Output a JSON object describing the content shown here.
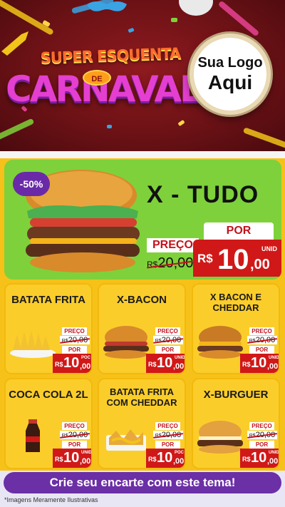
{
  "header": {
    "title_line1": "SUPER ESQUENTA",
    "title_de": "DE",
    "title_line2": "CARNAVAL",
    "logo_line1": "Sua Logo",
    "logo_line2": "Aqui"
  },
  "featured": {
    "discount": "-50%",
    "name": "X - TUDO",
    "price_label": "PREÇO",
    "old_currency": "R$",
    "old_price": "20,00",
    "por_label": "POR",
    "new_currency": "R$",
    "new_price_main": "10",
    "new_price_cents": ",00",
    "unit": "UNID"
  },
  "products": [
    {
      "name": "BATATA FRITA",
      "price_label": "PREÇO",
      "old_currency": "R$",
      "old_price": "20,00",
      "por_label": "POR",
      "currency": "R$",
      "main": "10",
      "cents": ",00",
      "unit": "POC"
    },
    {
      "name": "X-BACON",
      "price_label": "PREÇO",
      "old_currency": "R$",
      "old_price": "20,00",
      "por_label": "POR",
      "currency": "R$",
      "main": "10",
      "cents": ",00",
      "unit": "UNID"
    },
    {
      "name": "X BACON E CHEDDAR",
      "price_label": "PREÇO",
      "old_currency": "R$",
      "old_price": "20,00",
      "por_label": "POR",
      "currency": "R$",
      "main": "10",
      "cents": ",00",
      "unit": "UNID"
    },
    {
      "name": "COCA COLA 2L",
      "price_label": "PREÇO",
      "old_currency": "R$",
      "old_price": "20,00",
      "por_label": "POR",
      "currency": "R$",
      "main": "10",
      "cents": ",00",
      "unit": "UNID"
    },
    {
      "name": "BATATA FRITA COM CHEDDAR",
      "price_label": "PREÇO",
      "old_currency": "R$",
      "old_price": "20,00",
      "por_label": "POR",
      "currency": "R$",
      "main": "10",
      "cents": ",00",
      "unit": "POC"
    },
    {
      "name": "X-BURGUER",
      "price_label": "PREÇO",
      "old_currency": "R$",
      "old_price": "20,00",
      "por_label": "POR",
      "currency": "R$",
      "main": "10",
      "cents": ",00",
      "unit": "UNID"
    }
  ],
  "footer": {
    "cta_label": "Crie seu encarte com este tema!",
    "disclaimer": "*Imagens Meramente Ilustrativas"
  },
  "colors": {
    "header_bg": "#6d1216",
    "featured_bg": "#7ed13a",
    "card_bg": "#fbcd2a",
    "price_red": "#d01818",
    "accent_purple": "#6b2fa6"
  }
}
